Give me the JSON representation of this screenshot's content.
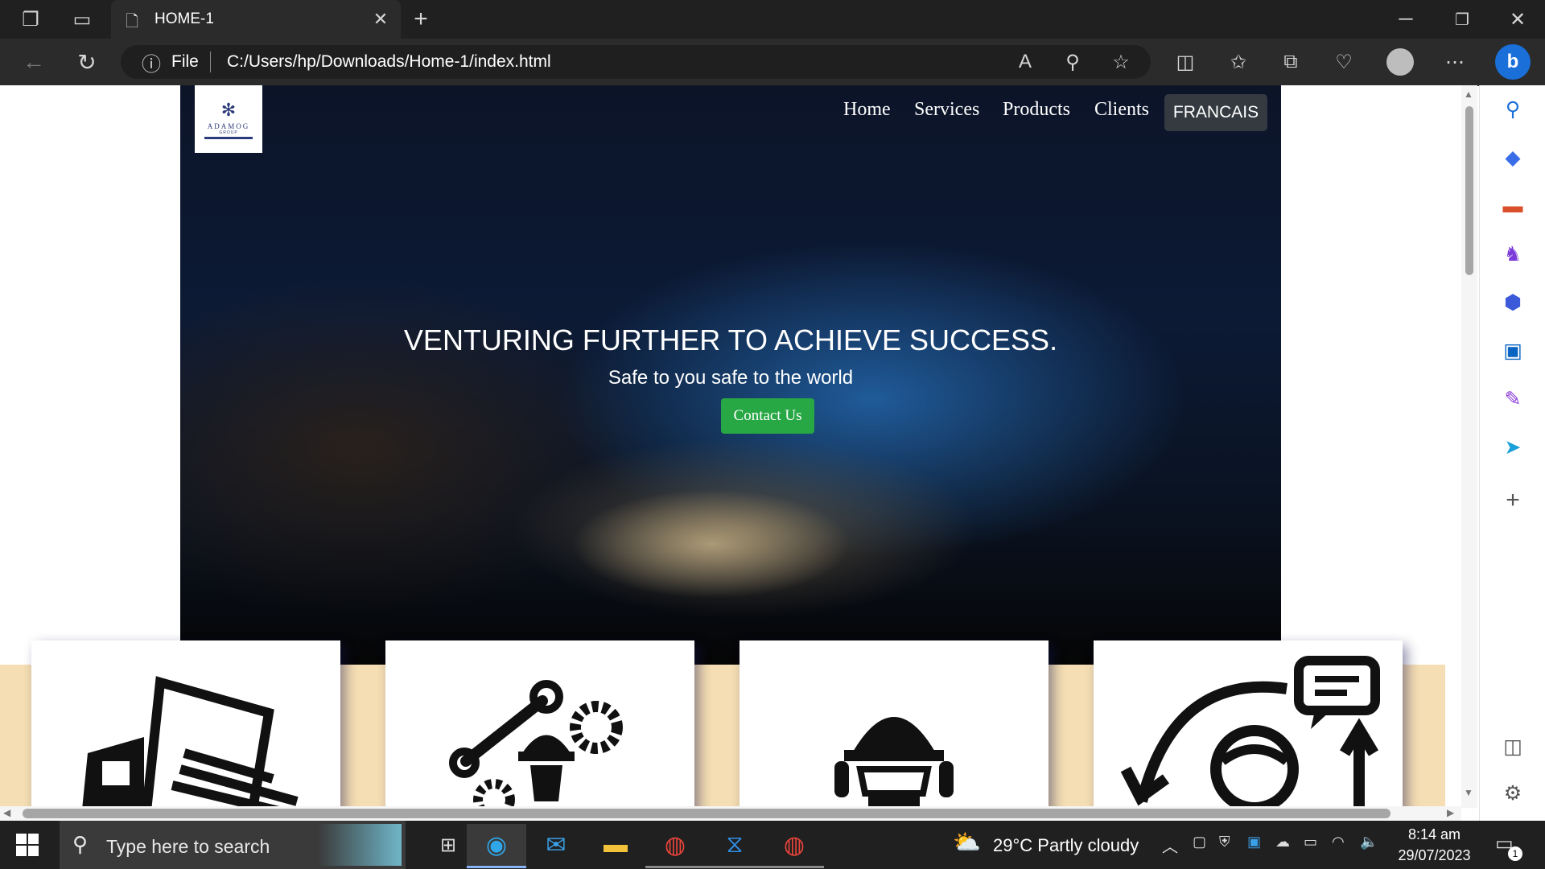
{
  "browser": {
    "tab_title": "HOME-1",
    "address_scheme": "File",
    "address_url": "C:/Users/hp/Downloads/Home-1/index.html"
  },
  "site": {
    "logo_text": "ADAMOG",
    "logo_sub": "GROUP",
    "nav": [
      "Home",
      "Services",
      "Products",
      "Clients"
    ],
    "language_button": "FRANCAIS",
    "hero_title": "VENTURING FURTHER TO ACHIEVE SUCCESS.",
    "hero_subtitle": "Safe to you safe to the world",
    "contact_button": "Contact Us",
    "cards": [
      {
        "icon": "delivery-truck-icon"
      },
      {
        "icon": "engineer-tools-icon"
      },
      {
        "icon": "worker-helmet-icon"
      },
      {
        "icon": "customer-support-icon"
      }
    ]
  },
  "taskbar": {
    "search_placeholder": "Type here to search",
    "weather_temp": "29°C",
    "weather_text": "Partly cloudy",
    "time": "8:14 am",
    "date": "29/07/2023",
    "notification_count": "1"
  }
}
